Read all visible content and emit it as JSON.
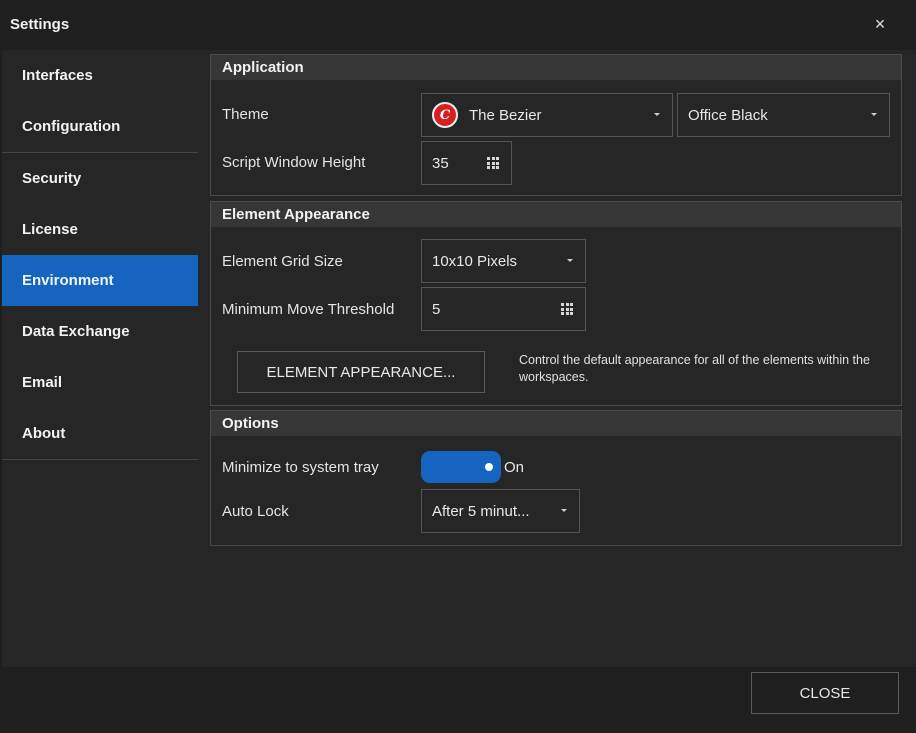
{
  "window": {
    "title": "Settings",
    "close_glyph": "×"
  },
  "sidebar": {
    "items": [
      {
        "label": "Interfaces"
      },
      {
        "label": "Configuration"
      },
      {
        "label": "Security"
      },
      {
        "label": "License"
      },
      {
        "label": "Environment",
        "active": true
      },
      {
        "label": "Data Exchange"
      },
      {
        "label": "Email"
      },
      {
        "label": "About"
      }
    ]
  },
  "application": {
    "heading": "Application",
    "theme_label": "Theme",
    "theme_value": "The Bezier",
    "theme_logo_glyph": "C",
    "skin_value": "Office Black",
    "script_height_label": "Script Window Height",
    "script_height_value": "35"
  },
  "element_appearance": {
    "heading": "Element Appearance",
    "grid_size_label": "Element Grid Size",
    "grid_size_value": "10x10 Pixels",
    "move_threshold_label": "Minimum Move Threshold",
    "move_threshold_value": "5",
    "button_label": "ELEMENT APPEARANCE...",
    "description": "Control the default appearance for all of the elements within the workspaces."
  },
  "options": {
    "heading": "Options",
    "minimize_label": "Minimize to system tray",
    "minimize_state": "On",
    "autolock_label": "Auto Lock",
    "autolock_value": "After 5 minut..."
  },
  "footer": {
    "close_label": "CLOSE"
  },
  "colors": {
    "accent": "#1565c0",
    "logo": "#d32020"
  }
}
